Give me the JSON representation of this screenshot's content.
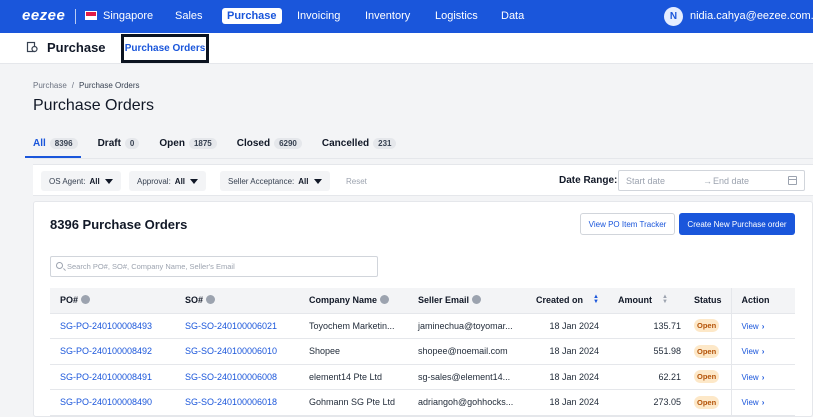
{
  "topnav": {
    "logo": "eezee",
    "country": "Singapore",
    "items": [
      {
        "label": "Sales",
        "active": false
      },
      {
        "label": "Purchase",
        "active": true
      },
      {
        "label": "Invoicing",
        "active": false
      },
      {
        "label": "Inventory",
        "active": false
      },
      {
        "label": "Logistics",
        "active": false
      },
      {
        "label": "Data",
        "active": false
      }
    ],
    "avatar_initial": "N",
    "user_email": "nidia.cahya@eezee.com.sg",
    "brand_color": "#1a56db"
  },
  "subheader": {
    "title": "Purchase",
    "active_tab": "Purchase Orders",
    "icon": "purchase-icon"
  },
  "breadcrumb": [
    "Purchase",
    "Purchase Orders"
  ],
  "page_title": "Purchase Orders",
  "status_tabs": [
    {
      "label": "All",
      "count": "8396",
      "active": true
    },
    {
      "label": "Draft",
      "count": "0",
      "active": false
    },
    {
      "label": "Open",
      "count": "1875",
      "active": false
    },
    {
      "label": "Closed",
      "count": "6290",
      "active": false
    },
    {
      "label": "Cancelled",
      "count": "231",
      "active": false
    }
  ],
  "filters": {
    "os_agent": {
      "label": "OS Agent:",
      "value": "All"
    },
    "approval": {
      "label": "Approval:",
      "value": "All"
    },
    "seller_acceptance": {
      "label": "Seller Acceptance:",
      "value": "All"
    },
    "reset_label": "Reset",
    "date_range": {
      "label": "Date Range:",
      "start_placeholder": "Start date",
      "end_placeholder": "End date",
      "separator": "→"
    }
  },
  "card": {
    "title": "8396 Purchase Orders",
    "view_tracker_label": "View PO Item Tracker",
    "create_label": "Create New Purchase order",
    "search_placeholder": "Search PO#, SO#, Company Name, Seller's Email"
  },
  "table": {
    "headers": {
      "po": "PO#",
      "so": "SO#",
      "company": "Company Name",
      "email": "Seller Email",
      "created": "Created on",
      "amount": "Amount",
      "status": "Status",
      "action": "Action"
    },
    "view_label": "View",
    "rows": [
      {
        "po": "SG-PO-240100008493",
        "so": "SG-SO-240100006021",
        "company": "Toyochem Marketin...",
        "email": "jaminechua@toyomar...",
        "created": "18 Jan 2024",
        "amount": "135.71",
        "status": "Open"
      },
      {
        "po": "SG-PO-240100008492",
        "so": "SG-SO-240100006010",
        "company": "Shopee",
        "email": "shopee@noemail.com",
        "created": "18 Jan 2024",
        "amount": "551.98",
        "status": "Open"
      },
      {
        "po": "SG-PO-240100008491",
        "so": "SG-SO-240100006008",
        "company": "element14 Pte Ltd",
        "email": "sg-sales@element14...",
        "created": "18 Jan 2024",
        "amount": "62.21",
        "status": "Open"
      },
      {
        "po": "SG-PO-240100008490",
        "so": "SG-SO-240100006018",
        "company": "Gohmann SG Pte Ltd",
        "email": "adriangoh@gohhocks...",
        "created": "18 Jan 2024",
        "amount": "273.05",
        "status": "Open"
      }
    ]
  }
}
